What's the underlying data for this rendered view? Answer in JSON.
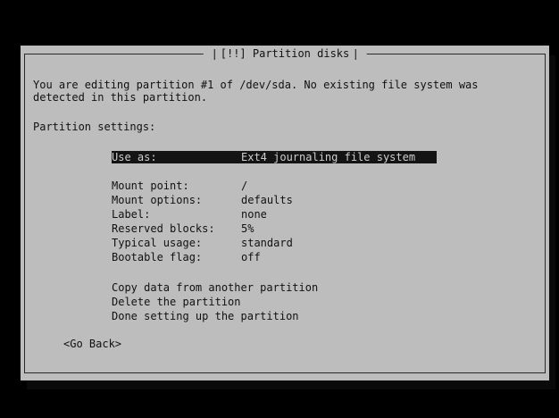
{
  "dialog": {
    "title": "[!!] Partition disks",
    "message": "You are editing partition #1 of /dev/sda. No existing file system was\ndetected in this partition.",
    "settings_heading": "Partition settings:"
  },
  "settings": [
    {
      "label": "Use as:",
      "value": "Ext4 journaling file system"
    },
    {
      "label": "Mount point:",
      "value": "/"
    },
    {
      "label": "Mount options:",
      "value": "defaults"
    },
    {
      "label": "Label:",
      "value": "none"
    },
    {
      "label": "Reserved blocks:",
      "value": "5%"
    },
    {
      "label": "Typical usage:",
      "value": "standard"
    },
    {
      "label": "Bootable flag:",
      "value": "off"
    }
  ],
  "actions": [
    "Copy data from another partition",
    "Delete the partition",
    "Done setting up the partition"
  ],
  "go_back_label": "<Go Back>",
  "colors": {
    "background": "#000000",
    "dialog": "#bdbdbd",
    "selection": "#141414"
  }
}
